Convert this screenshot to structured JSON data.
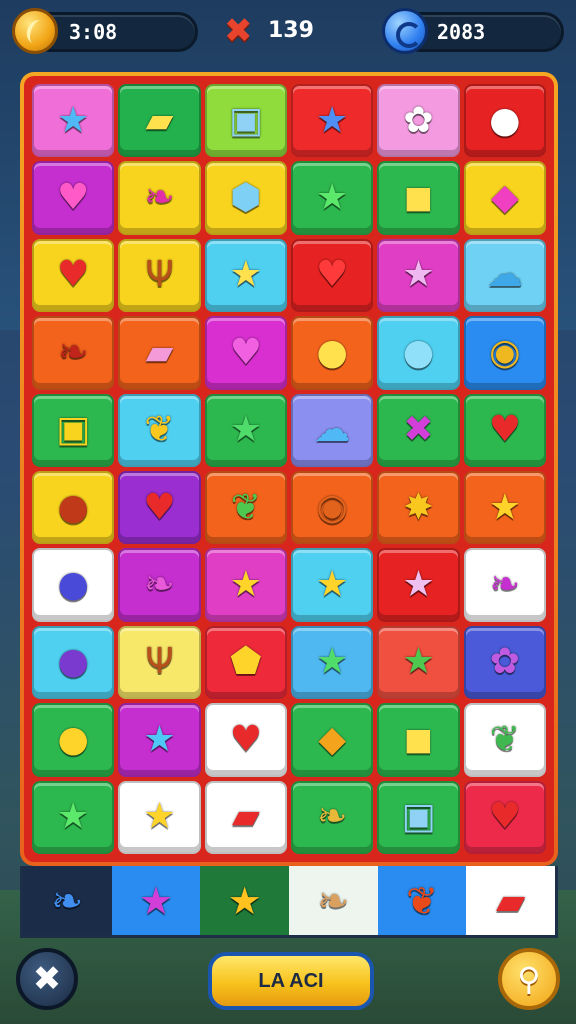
{
  "hud": {
    "time": "3:08",
    "moves": "139",
    "gems": "2083"
  },
  "button_label": "LA ACI",
  "board": [
    [
      {
        "c": "#f06ed8",
        "s": "★",
        "k": "#4fb8f5"
      },
      {
        "c": "#22b14c",
        "s": "▰",
        "k": "#ffe14d"
      },
      {
        "c": "#8fdc3c",
        "s": "▣",
        "k": "#8fd2f5"
      },
      {
        "c": "#ee2a2a",
        "s": "★",
        "k": "#4f8ef5"
      },
      {
        "c": "#f49ae0",
        "s": "✿",
        "k": "#ffffff"
      },
      {
        "c": "#e62222",
        "s": "●",
        "k": "#ffffff"
      }
    ],
    [
      {
        "c": "#c52ecf",
        "s": "♥",
        "k": "#ff5ac8"
      },
      {
        "c": "#f8d41e",
        "s": "❧",
        "k": "#e02fa8"
      },
      {
        "c": "#f8d41e",
        "s": "⬢",
        "k": "#7fd0f5"
      },
      {
        "c": "#2db84f",
        "s": "★",
        "k": "#5ce86b"
      },
      {
        "c": "#2db84f",
        "s": "◼",
        "k": "#ffe14d"
      },
      {
        "c": "#f8d41e",
        "s": "◆",
        "k": "#f03fc0"
      }
    ],
    [
      {
        "c": "#f8d41e",
        "s": "♥",
        "k": "#e82a2a"
      },
      {
        "c": "#f8d41e",
        "s": "Ψ",
        "k": "#b8501a"
      },
      {
        "c": "#4fd0f0",
        "s": "★",
        "k": "#ffe14d"
      },
      {
        "c": "#e62222",
        "s": "♥",
        "k": "#ff3a3a"
      },
      {
        "c": "#e03fc5",
        "s": "★",
        "k": "#f0b8f0"
      },
      {
        "c": "#6fd2f5",
        "s": "☁",
        "k": "#3fa8e8"
      }
    ],
    [
      {
        "c": "#f3631c",
        "s": "❧",
        "k": "#c0241a"
      },
      {
        "c": "#f3631c",
        "s": "▰",
        "k": "#f59ad8"
      },
      {
        "c": "#d92fd0",
        "s": "♥",
        "k": "#f060e0"
      },
      {
        "c": "#f3631c",
        "s": "●",
        "k": "#ffe14d"
      },
      {
        "c": "#4fd0f0",
        "s": "●",
        "k": "#8fe0f8"
      },
      {
        "c": "#2a8cf0",
        "s": "◉",
        "k": "#f0b820"
      }
    ],
    [
      {
        "c": "#2db84f",
        "s": "▣",
        "k": "#f8d41e"
      },
      {
        "c": "#4fd0f0",
        "s": "❦",
        "k": "#f8c81e"
      },
      {
        "c": "#2db84f",
        "s": "★",
        "k": "#4fdc6b"
      },
      {
        "c": "#8a8ff0",
        "s": "☁",
        "k": "#4fb8f5"
      },
      {
        "c": "#2db84f",
        "s": "✖",
        "k": "#d23fd8"
      },
      {
        "c": "#2db84f",
        "s": "♥",
        "k": "#e82a2a"
      }
    ],
    [
      {
        "c": "#f8d41e",
        "s": "●",
        "k": "#c03a1a"
      },
      {
        "c": "#9a2ed0",
        "s": "♥",
        "k": "#e82a2a"
      },
      {
        "c": "#f3631c",
        "s": "❦",
        "k": "#4fc84f"
      },
      {
        "c": "#f3631c",
        "s": "◉",
        "k": "#e2641c"
      },
      {
        "c": "#f3631c",
        "s": "✸",
        "k": "#f8c81e"
      },
      {
        "c": "#f3631c",
        "s": "★",
        "k": "#ffd42a"
      }
    ],
    [
      {
        "c": "#ffffff",
        "s": "●",
        "k": "#4a4ad8"
      },
      {
        "c": "#c52ecf",
        "s": "❧",
        "k": "#e85ad8"
      },
      {
        "c": "#e03fc5",
        "s": "★",
        "k": "#ffd42a"
      },
      {
        "c": "#4fd0f0",
        "s": "★",
        "k": "#ffd42a"
      },
      {
        "c": "#e62222",
        "s": "★",
        "k": "#f0c0f0"
      },
      {
        "c": "#ffffff",
        "s": "❧",
        "k": "#c52ecf"
      }
    ],
    [
      {
        "c": "#4fd0f0",
        "s": "●",
        "k": "#7a3ad0"
      },
      {
        "c": "#f8e86a",
        "s": "Ψ",
        "k": "#b8501a"
      },
      {
        "c": "#ee2a3a",
        "s": "⬟",
        "k": "#ffd42a"
      },
      {
        "c": "#4fb8f0",
        "s": "★",
        "k": "#4fdc6b"
      },
      {
        "c": "#f05040",
        "s": "★",
        "k": "#4fc84f"
      },
      {
        "c": "#4a5ad8",
        "s": "✿",
        "k": "#c05ae0"
      }
    ],
    [
      {
        "c": "#2db84f",
        "s": "●",
        "k": "#ffd42a"
      },
      {
        "c": "#c52ecf",
        "s": "★",
        "k": "#4fc8f5"
      },
      {
        "c": "#ffffff",
        "s": "♥",
        "k": "#e82a2a"
      },
      {
        "c": "#2db84f",
        "s": "◆",
        "k": "#f3a31c"
      },
      {
        "c": "#2db84f",
        "s": "◼",
        "k": "#ffe14d"
      },
      {
        "c": "#ffffff",
        "s": "❦",
        "k": "#3fb84f"
      }
    ],
    [
      {
        "c": "#2db84f",
        "s": "★",
        "k": "#5ce86b"
      },
      {
        "c": "#ffffff",
        "s": "★",
        "k": "#ffd42a"
      },
      {
        "c": "#ffffff",
        "s": "▰",
        "k": "#e82a2a"
      },
      {
        "c": "#2db84f",
        "s": "❧",
        "k": "#e8b83a"
      },
      {
        "c": "#2db84f",
        "s": "▣",
        "k": "#8fd2f5"
      },
      {
        "c": "#ee2a4a",
        "s": "♥",
        "k": "#e82a2a"
      }
    ]
  ],
  "tray": [
    {
      "c": "#1a2c48",
      "s": "❧",
      "k": "#3f8ef0"
    },
    {
      "c": "#2a8cf0",
      "s": "★",
      "k": "#d23fd8"
    },
    {
      "c": "#1f7a3a",
      "s": "★",
      "k": "#ffc21e"
    },
    {
      "c": "#eef4ee",
      "s": "❧",
      "k": "#d9a060"
    },
    {
      "c": "#2a8cf0",
      "s": "❦",
      "k": "#e84a1a"
    },
    {
      "c": "#ffffff",
      "s": "▰",
      "k": "#e82a2a"
    }
  ]
}
